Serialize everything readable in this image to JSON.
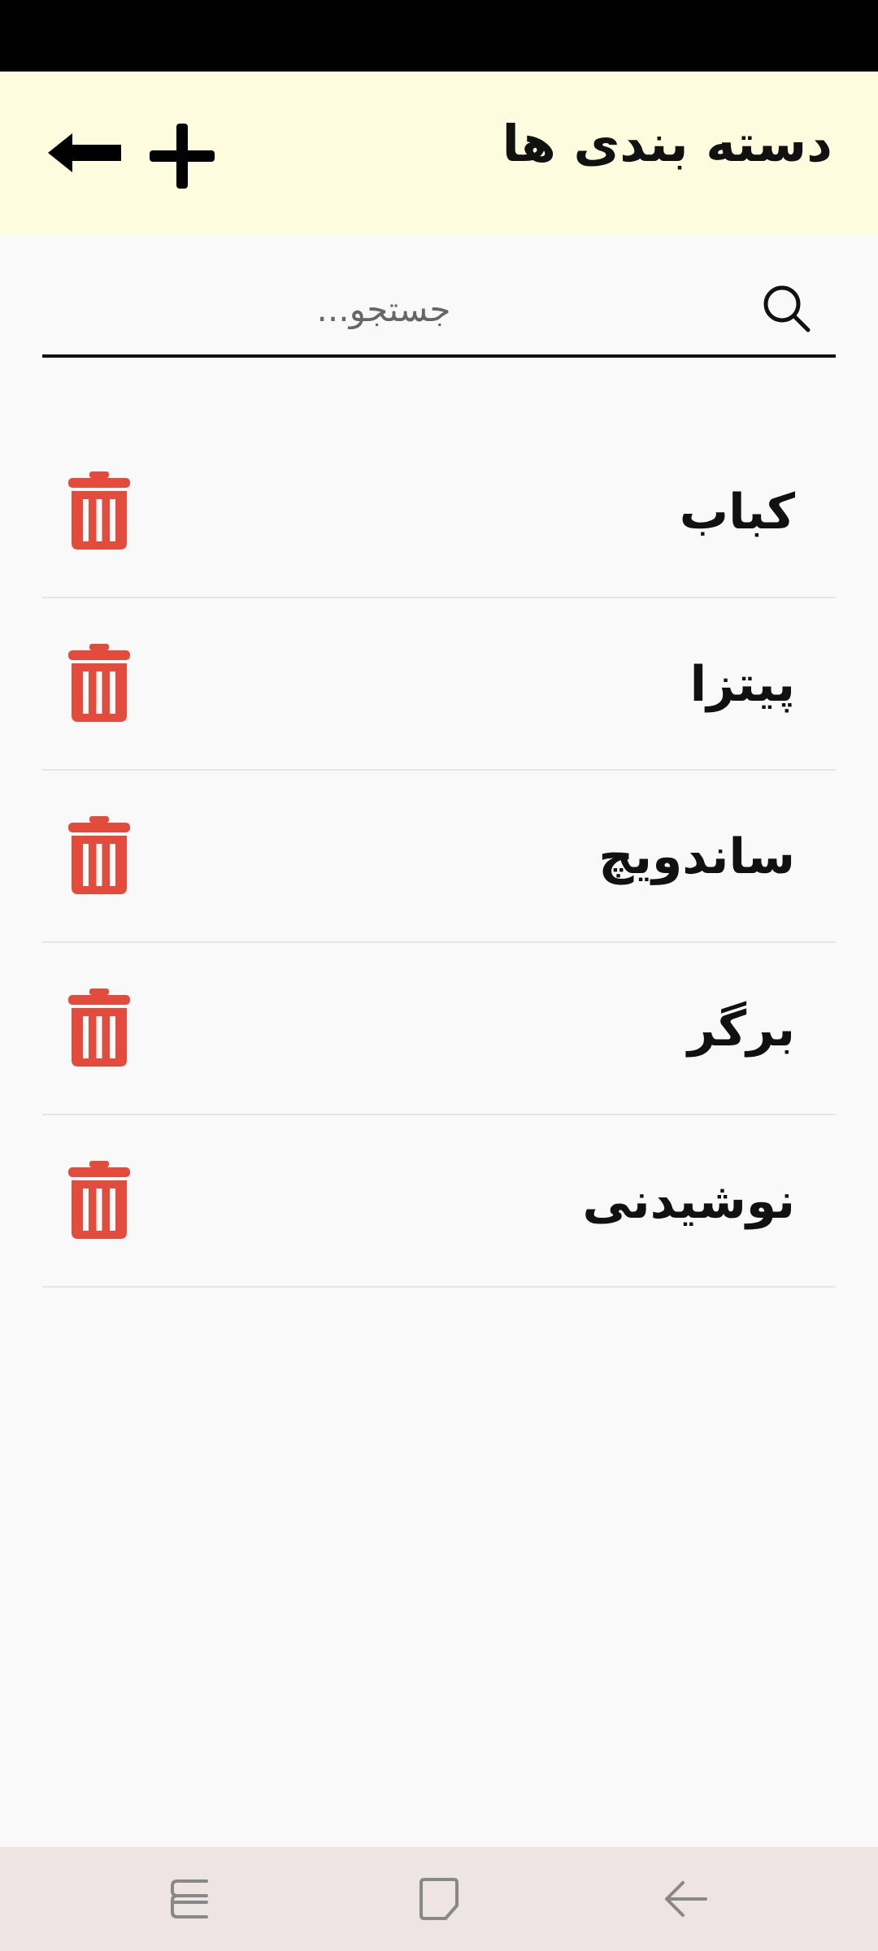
{
  "appbar": {
    "title": "دسته بندی ها",
    "back_icon": "arrow-left-icon",
    "add_icon": "plus-icon"
  },
  "search": {
    "placeholder": "جستجو...",
    "icon": "search-icon"
  },
  "categories": [
    {
      "label": "کباب"
    },
    {
      "label": "پیتزا"
    },
    {
      "label": "ساندویچ"
    },
    {
      "label": "برگر"
    },
    {
      "label": "نوشیدنی"
    }
  ],
  "delete_icon": "trash-icon",
  "navbar": {
    "items": [
      "recent-apps-icon",
      "home-icon",
      "back-icon"
    ]
  },
  "colors": {
    "appbar_bg": "#fefcdf",
    "delete_red": "#e34b3c",
    "navbar_bg": "#efe4e4"
  }
}
